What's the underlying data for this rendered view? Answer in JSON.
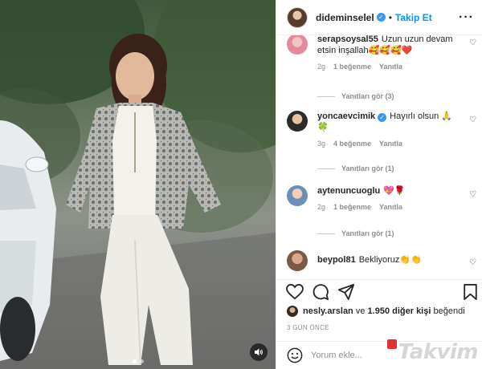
{
  "post": {
    "username": "dideminselel",
    "verified": true,
    "follow_separator": "•",
    "follow_label": "Takip Et",
    "more_label": "···"
  },
  "comments": [
    {
      "username": "serapsoysal55",
      "text": "Uzun uzun devam etsin inşallah🥰🥰🥰❤️",
      "verified": false,
      "time": "2g",
      "likes": "1 beğenme",
      "reply": "Yanıtla",
      "view_replies": "Yanıtları gör (3)"
    },
    {
      "username": "yoncaevcimik",
      "text": "Hayırlı olsun 🙏",
      "extra": "🍀",
      "verified": true,
      "time": "3g",
      "likes": "4 beğenme",
      "reply": "Yanıtla",
      "view_replies": "Yanıtları gör (1)"
    },
    {
      "username": "aytenuncuoglu",
      "text": "💖🌹",
      "verified": false,
      "time": "2g",
      "likes": "1 beğenme",
      "reply": "Yanıtla",
      "view_replies": "Yanıtları gör (1)"
    },
    {
      "username": "beypol81",
      "text": "Bekliyoruz👏👏",
      "verified": false
    }
  ],
  "likes_line": {
    "user": "nesly.arslan",
    "connector": "ve",
    "others": "1.950 diğer kişi",
    "suffix": "beğendi"
  },
  "time_ago": "3 GÜN ÖNCE",
  "add_comment": {
    "placeholder": "Yorum ekle..."
  },
  "watermark": "Takvim",
  "icons": {
    "heart": "heart-icon",
    "comment": "comment-icon",
    "share": "share-icon",
    "save": "bookmark-icon",
    "emoji": "smile-icon",
    "mute": "speaker-icon"
  },
  "colors": {
    "accent": "#0095f6",
    "verified": "#3897f0",
    "meta": "#8e8e8e",
    "text": "#262626"
  },
  "carousel": {
    "count": 2,
    "active": 1
  }
}
